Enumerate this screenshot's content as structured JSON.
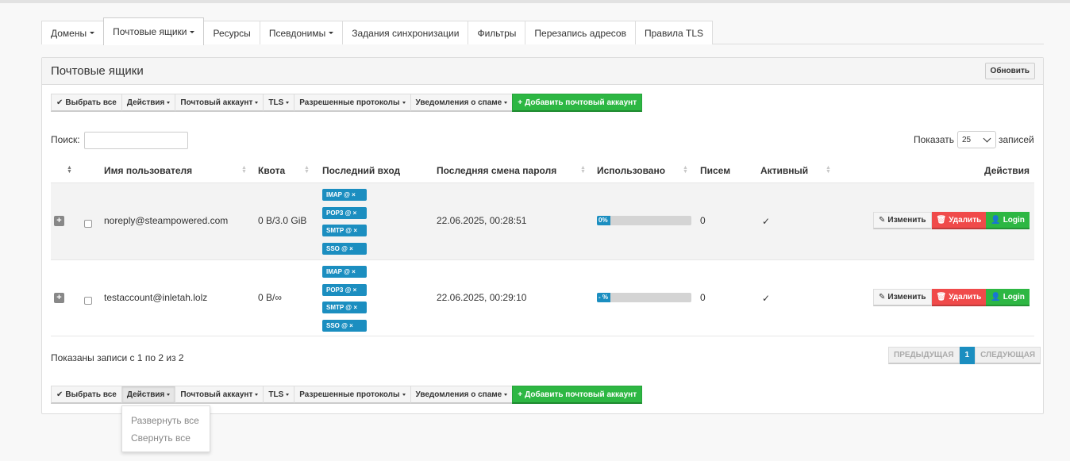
{
  "tabs": [
    {
      "label": "Домены",
      "dropdown": true
    },
    {
      "label": "Почтовые ящики",
      "dropdown": true,
      "active": true
    },
    {
      "label": "Ресурсы",
      "dropdown": false
    },
    {
      "label": "Псевдонимы",
      "dropdown": true
    },
    {
      "label": "Задания синхронизации",
      "dropdown": false
    },
    {
      "label": "Фильтры",
      "dropdown": false
    },
    {
      "label": "Перезапись адресов",
      "dropdown": false
    },
    {
      "label": "Правила TLS",
      "dropdown": false
    }
  ],
  "panel": {
    "title": "Почтовые ящики",
    "refresh_label": "Обновить"
  },
  "toolbar": {
    "select_all": "Выбрать все",
    "actions": "Действия",
    "mail_account": "Почтовый аккаунт",
    "tls": "TLS",
    "protocols": "Разрешенные протоколы",
    "spam": "Уведомления о спаме",
    "add_account": "Добавить почтовый аккаунт"
  },
  "search": {
    "label": "Поиск:",
    "value": ""
  },
  "length": {
    "show_label": "Показать",
    "value": "25",
    "records_label": "записей"
  },
  "columns": {
    "username": "Имя пользователя",
    "quota": "Квота",
    "last_login": "Последний вход",
    "last_pw_change": "Последняя смена пароля",
    "used": "Использовано",
    "messages": "Писем",
    "active": "Активный",
    "actions": "Действия"
  },
  "rows": [
    {
      "username": "noreply@steampowered.com",
      "quota": "0 B/3.0 GiB",
      "protocols": [
        "IMAP @ ×",
        "POP3 @ ×",
        "SMTP @ ×",
        "SSO @ ×"
      ],
      "pw_change": "22.06.2025, 00:28:51",
      "usage_label": "0%",
      "usage_fraction": 0,
      "messages": "0",
      "active": "✓"
    },
    {
      "username": "testaccount@inletah.lolz",
      "quota": "0 B/∞",
      "protocols": [
        "IMAP @ ×",
        "POP3 @ ×",
        "SMTP @ ×",
        "SSO @ ×"
      ],
      "pw_change": "22.06.2025, 00:29:10",
      "usage_label": "- %",
      "usage_fraction": 0,
      "messages": "0",
      "active": "✓"
    }
  ],
  "row_actions": {
    "edit": "Изменить",
    "delete": "Удалить",
    "login": "Login"
  },
  "info": "Показаны записи с 1 по 2 из 2",
  "pager": {
    "prev": "ПРЕДЫДУЩАЯ",
    "page": "1",
    "next": "СЛЕДУЮЩАЯ"
  },
  "dropdown": {
    "expand_all": "Развернуть все",
    "collapse_all": "Свернуть все"
  },
  "colors": {
    "accent": "#1b8ec0",
    "success": "#2db743",
    "danger": "#f04a4a"
  }
}
